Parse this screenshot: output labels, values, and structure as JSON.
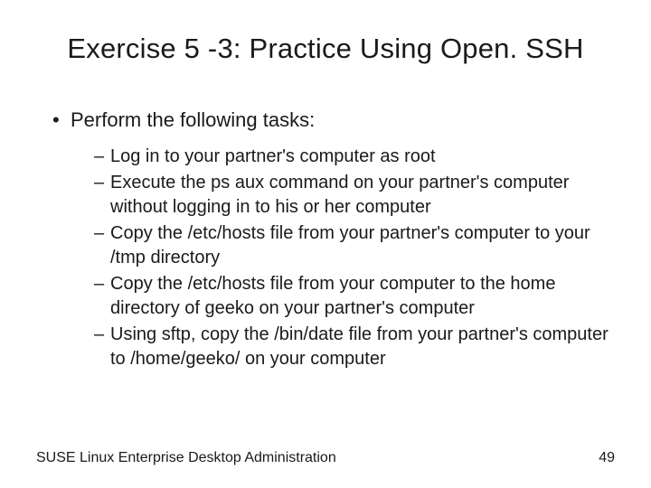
{
  "title": "Exercise 5 -3: Practice Using Open. SSH",
  "lead": "Perform the following tasks:",
  "tasks": [
    "Log in to your partner's computer as root",
    "Execute the ps aux command on your partner's computer without logging in to his or her computer",
    "Copy the /etc/hosts file from your partner's computer to your /tmp directory",
    "Copy the /etc/hosts file from your computer to the home directory of geeko on your partner's computer",
    "Using sftp, copy the /bin/date file from your partner's computer to /home/geeko/ on your computer"
  ],
  "footer_left": "SUSE Linux Enterprise Desktop Administration",
  "footer_right": "49"
}
